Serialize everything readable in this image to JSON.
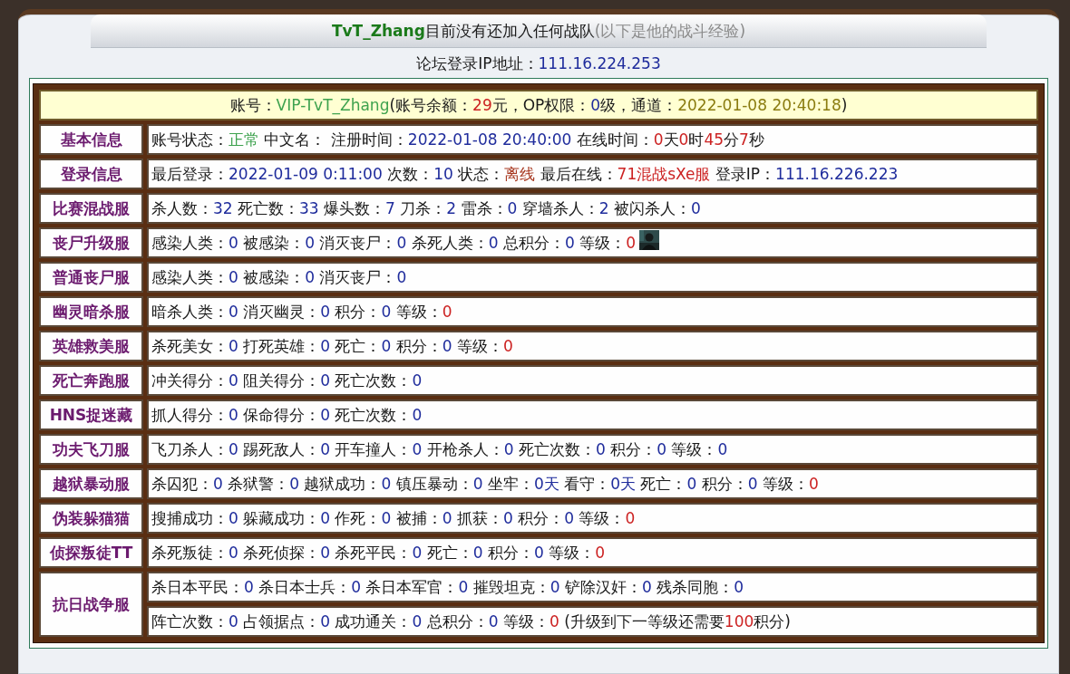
{
  "header": {
    "title": [
      {
        "text": "TvT_Zhang",
        "kind": "name"
      },
      {
        "text": "目前没有还加入任何战队",
        "kind": "plain"
      },
      {
        "text": "(以下是他的战斗经验)",
        "kind": "gray"
      }
    ]
  },
  "forum_ip": [
    {
      "text": "论坛登录IP地址：",
      "kind": "plain"
    },
    {
      "text": "111.16.224.253",
      "kind": "value"
    }
  ],
  "account": [
    {
      "text": "账号：",
      "kind": "plain"
    },
    {
      "text": "VIP-TvT_Zhang",
      "kind": "green"
    },
    {
      "text": "(账号余额：",
      "kind": "plain"
    },
    {
      "text": "29",
      "kind": "red"
    },
    {
      "text": "元，OP权限：",
      "kind": "plain"
    },
    {
      "text": "0",
      "kind": "value"
    },
    {
      "text": "级，通道：",
      "kind": "plain"
    },
    {
      "text": "2022-01-08 20:40:18",
      "kind": "olive"
    },
    {
      "text": ")",
      "kind": "plain"
    }
  ],
  "rows": [
    {
      "label": "基本信息",
      "lines": [
        [
          {
            "text": "账号状态：",
            "kind": "plain"
          },
          {
            "text": "正常",
            "kind": "green"
          },
          {
            "text": " 中文名： 注册时间：",
            "kind": "plain"
          },
          {
            "text": "2022-01-08 20:40:00",
            "kind": "value"
          },
          {
            "text": " 在线时间：",
            "kind": "plain"
          },
          {
            "text": "0",
            "kind": "red"
          },
          {
            "text": "天",
            "kind": "plain"
          },
          {
            "text": "0",
            "kind": "red"
          },
          {
            "text": "时",
            "kind": "plain"
          },
          {
            "text": "45",
            "kind": "red"
          },
          {
            "text": "分",
            "kind": "plain"
          },
          {
            "text": "7",
            "kind": "red"
          },
          {
            "text": "秒",
            "kind": "plain"
          }
        ]
      ]
    },
    {
      "label": "登录信息",
      "lines": [
        [
          {
            "text": "最后登录：",
            "kind": "plain"
          },
          {
            "text": "2022-01-09 0:11:00",
            "kind": "value"
          },
          {
            "text": " 次数：",
            "kind": "plain"
          },
          {
            "text": "10",
            "kind": "value"
          },
          {
            "text": " 状态：",
            "kind": "plain"
          },
          {
            "text": "离线",
            "kind": "brown"
          },
          {
            "text": " 最后在线：",
            "kind": "plain"
          },
          {
            "text": "71混战sXe服",
            "kind": "red"
          },
          {
            "text": " 登录IP：",
            "kind": "plain"
          },
          {
            "text": "111.16.226.223",
            "kind": "value"
          }
        ]
      ]
    },
    {
      "label": "比赛混战服",
      "lines": [
        [
          {
            "text": "杀人数：",
            "kind": "plain"
          },
          {
            "text": "32",
            "kind": "value"
          },
          {
            "text": " 死亡数：",
            "kind": "plain"
          },
          {
            "text": "33",
            "kind": "value"
          },
          {
            "text": " 爆头数：",
            "kind": "plain"
          },
          {
            "text": "7",
            "kind": "value"
          },
          {
            "text": " 刀杀：",
            "kind": "plain"
          },
          {
            "text": "2",
            "kind": "value"
          },
          {
            "text": " 雷杀：",
            "kind": "plain"
          },
          {
            "text": "0",
            "kind": "value"
          },
          {
            "text": " 穿墙杀人：",
            "kind": "plain"
          },
          {
            "text": "2",
            "kind": "value"
          },
          {
            "text": " 被闪杀人：",
            "kind": "plain"
          },
          {
            "text": "0",
            "kind": "value"
          }
        ]
      ]
    },
    {
      "label": "丧尸升级服",
      "lines": [
        [
          {
            "text": "感染人类：",
            "kind": "plain"
          },
          {
            "text": "0",
            "kind": "value"
          },
          {
            "text": " 被感染：",
            "kind": "plain"
          },
          {
            "text": "0",
            "kind": "value"
          },
          {
            "text": " 消灭丧尸：",
            "kind": "plain"
          },
          {
            "text": "0",
            "kind": "value"
          },
          {
            "text": " 杀死人类：",
            "kind": "plain"
          },
          {
            "text": "0",
            "kind": "value"
          },
          {
            "text": " 总积分：",
            "kind": "plain"
          },
          {
            "text": "0",
            "kind": "value"
          },
          {
            "text": " 等级：",
            "kind": "plain"
          },
          {
            "text": "0",
            "kind": "red"
          },
          {
            "kind": "picture"
          }
        ]
      ]
    },
    {
      "label": "普通丧尸服",
      "lines": [
        [
          {
            "text": "感染人类：",
            "kind": "plain"
          },
          {
            "text": "0",
            "kind": "value"
          },
          {
            "text": " 被感染：",
            "kind": "plain"
          },
          {
            "text": "0",
            "kind": "value"
          },
          {
            "text": " 消灭丧尸：",
            "kind": "plain"
          },
          {
            "text": "0",
            "kind": "value"
          }
        ]
      ]
    },
    {
      "label": "幽灵暗杀服",
      "lines": [
        [
          {
            "text": "暗杀人类：",
            "kind": "plain"
          },
          {
            "text": "0",
            "kind": "value"
          },
          {
            "text": " 消灭幽灵：",
            "kind": "plain"
          },
          {
            "text": "0",
            "kind": "value"
          },
          {
            "text": " 积分：",
            "kind": "plain"
          },
          {
            "text": "0",
            "kind": "value"
          },
          {
            "text": " 等级：",
            "kind": "plain"
          },
          {
            "text": "0",
            "kind": "red"
          }
        ]
      ]
    },
    {
      "label": "英雄救美服",
      "lines": [
        [
          {
            "text": "杀死美女：",
            "kind": "plain"
          },
          {
            "text": "0",
            "kind": "value"
          },
          {
            "text": " 打死英雄：",
            "kind": "plain"
          },
          {
            "text": "0",
            "kind": "value"
          },
          {
            "text": " 死亡：",
            "kind": "plain"
          },
          {
            "text": "0",
            "kind": "value"
          },
          {
            "text": " 积分：",
            "kind": "plain"
          },
          {
            "text": "0",
            "kind": "value"
          },
          {
            "text": " 等级：",
            "kind": "plain"
          },
          {
            "text": "0",
            "kind": "red"
          }
        ]
      ]
    },
    {
      "label": "死亡奔跑服",
      "lines": [
        [
          {
            "text": "冲关得分：",
            "kind": "plain"
          },
          {
            "text": "0",
            "kind": "value"
          },
          {
            "text": " 阻关得分：",
            "kind": "plain"
          },
          {
            "text": "0",
            "kind": "value"
          },
          {
            "text": " 死亡次数：",
            "kind": "plain"
          },
          {
            "text": "0",
            "kind": "value"
          }
        ]
      ]
    },
    {
      "label": "HNS捉迷藏",
      "lines": [
        [
          {
            "text": "抓人得分：",
            "kind": "plain"
          },
          {
            "text": "0",
            "kind": "value"
          },
          {
            "text": " 保命得分：",
            "kind": "plain"
          },
          {
            "text": "0",
            "kind": "value"
          },
          {
            "text": " 死亡次数：",
            "kind": "plain"
          },
          {
            "text": "0",
            "kind": "value"
          }
        ]
      ]
    },
    {
      "label": "功夫飞刀服",
      "lines": [
        [
          {
            "text": "飞刀杀人：",
            "kind": "plain"
          },
          {
            "text": "0",
            "kind": "value"
          },
          {
            "text": " 踢死敌人：",
            "kind": "plain"
          },
          {
            "text": "0",
            "kind": "value"
          },
          {
            "text": " 开车撞人：",
            "kind": "plain"
          },
          {
            "text": "0",
            "kind": "value"
          },
          {
            "text": " 开枪杀人：",
            "kind": "plain"
          },
          {
            "text": "0",
            "kind": "value"
          },
          {
            "text": " 死亡次数：",
            "kind": "plain"
          },
          {
            "text": "0",
            "kind": "value"
          },
          {
            "text": " 积分：",
            "kind": "plain"
          },
          {
            "text": "0",
            "kind": "value"
          },
          {
            "text": " 等级：",
            "kind": "plain"
          },
          {
            "text": "0",
            "kind": "value"
          }
        ]
      ]
    },
    {
      "label": "越狱暴动服",
      "lines": [
        [
          {
            "text": "杀囚犯：",
            "kind": "plain"
          },
          {
            "text": "0",
            "kind": "value"
          },
          {
            "text": " 杀狱警：",
            "kind": "plain"
          },
          {
            "text": "0",
            "kind": "value"
          },
          {
            "text": " 越狱成功：",
            "kind": "plain"
          },
          {
            "text": "0",
            "kind": "value"
          },
          {
            "text": " 镇压暴动：",
            "kind": "plain"
          },
          {
            "text": "0",
            "kind": "value"
          },
          {
            "text": " 坐牢：",
            "kind": "plain"
          },
          {
            "text": "0天",
            "kind": "value"
          },
          {
            "text": " 看守：",
            "kind": "plain"
          },
          {
            "text": "0天",
            "kind": "value"
          },
          {
            "text": " 死亡：",
            "kind": "plain"
          },
          {
            "text": "0",
            "kind": "value"
          },
          {
            "text": " 积分：",
            "kind": "plain"
          },
          {
            "text": "0",
            "kind": "value"
          },
          {
            "text": " 等级：",
            "kind": "plain"
          },
          {
            "text": "0",
            "kind": "red"
          }
        ]
      ]
    },
    {
      "label": "伪装躲猫猫",
      "lines": [
        [
          {
            "text": "搜捕成功：",
            "kind": "plain"
          },
          {
            "text": "0",
            "kind": "value"
          },
          {
            "text": " 躲藏成功：",
            "kind": "plain"
          },
          {
            "text": "0",
            "kind": "value"
          },
          {
            "text": " 作死：",
            "kind": "plain"
          },
          {
            "text": "0",
            "kind": "value"
          },
          {
            "text": " 被捕：",
            "kind": "plain"
          },
          {
            "text": "0",
            "kind": "value"
          },
          {
            "text": " 抓获：",
            "kind": "plain"
          },
          {
            "text": "0",
            "kind": "value"
          },
          {
            "text": " 积分：",
            "kind": "plain"
          },
          {
            "text": "0",
            "kind": "value"
          },
          {
            "text": " 等级：",
            "kind": "plain"
          },
          {
            "text": "0",
            "kind": "red"
          }
        ]
      ]
    },
    {
      "label": "侦探叛徒TT",
      "lines": [
        [
          {
            "text": "杀死叛徒：",
            "kind": "plain"
          },
          {
            "text": "0",
            "kind": "value"
          },
          {
            "text": " 杀死侦探：",
            "kind": "plain"
          },
          {
            "text": "0",
            "kind": "value"
          },
          {
            "text": " 杀死平民：",
            "kind": "plain"
          },
          {
            "text": "0",
            "kind": "value"
          },
          {
            "text": " 死亡：",
            "kind": "plain"
          },
          {
            "text": "0",
            "kind": "value"
          },
          {
            "text": " 积分：",
            "kind": "plain"
          },
          {
            "text": "0",
            "kind": "value"
          },
          {
            "text": " 等级：",
            "kind": "plain"
          },
          {
            "text": "0",
            "kind": "red"
          }
        ]
      ]
    },
    {
      "label": "抗日战争服",
      "lines": [
        [
          {
            "text": "杀日本平民：",
            "kind": "plain"
          },
          {
            "text": "0",
            "kind": "value"
          },
          {
            "text": " 杀日本士兵：",
            "kind": "plain"
          },
          {
            "text": "0",
            "kind": "value"
          },
          {
            "text": " 杀日本军官：",
            "kind": "plain"
          },
          {
            "text": "0",
            "kind": "value"
          },
          {
            "text": " 摧毁坦克：",
            "kind": "plain"
          },
          {
            "text": "0",
            "kind": "value"
          },
          {
            "text": " 铲除汉奸：",
            "kind": "plain"
          },
          {
            "text": "0",
            "kind": "value"
          },
          {
            "text": " 残杀同胞：",
            "kind": "plain"
          },
          {
            "text": "0",
            "kind": "value"
          }
        ],
        [
          {
            "text": "阵亡次数：",
            "kind": "plain"
          },
          {
            "text": "0",
            "kind": "value"
          },
          {
            "text": " 占领据点：",
            "kind": "plain"
          },
          {
            "text": "0",
            "kind": "value"
          },
          {
            "text": " 成功通关：",
            "kind": "plain"
          },
          {
            "text": "0",
            "kind": "value"
          },
          {
            "text": " 总积分：",
            "kind": "plain"
          },
          {
            "text": "0",
            "kind": "value"
          },
          {
            "text": " 等级：",
            "kind": "plain"
          },
          {
            "text": "0",
            "kind": "red"
          },
          {
            "text": " (升级到下一等级还需要",
            "kind": "plain"
          },
          {
            "text": "100",
            "kind": "red"
          },
          {
            "text": "积分)",
            "kind": "plain"
          }
        ]
      ]
    }
  ]
}
